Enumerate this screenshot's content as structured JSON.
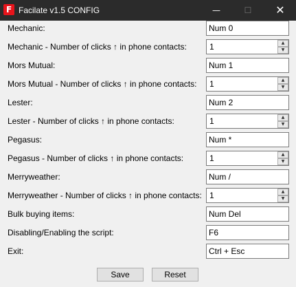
{
  "window": {
    "title": "Facilate v1.5 CONFIG",
    "icon_letter": "F",
    "minimize_glyph": "—",
    "maximize_glyph": "☐",
    "close_glyph": "✕",
    "icon": "app-logo-icon",
    "accent_color": "#e8141b"
  },
  "fields": {
    "mechanic_key": {
      "label": "Mechanic:",
      "value": "Num 0"
    },
    "mechanic_clicks": {
      "label": "Mechanic - Number of clicks ↑ in phone contacts:",
      "value": "1"
    },
    "mors_key": {
      "label": "Mors Mutual:",
      "value": "Num 1"
    },
    "mors_clicks": {
      "label": "Mors Mutual - Number of clicks ↑ in phone contacts:",
      "value": "1"
    },
    "lester_key": {
      "label": "Lester:",
      "value": "Num 2"
    },
    "lester_clicks": {
      "label": "Lester - Number of clicks ↑ in phone contacts:",
      "value": "1"
    },
    "pegasus_key": {
      "label": "Pegasus:",
      "value": "Num *"
    },
    "pegasus_clicks": {
      "label": "Pegasus - Number of clicks ↑ in phone contacts:",
      "value": "1"
    },
    "merry_key": {
      "label": "Merryweather:",
      "value": "Num /"
    },
    "merry_clicks": {
      "label": "Merryweather - Number of clicks ↑ in phone contacts:",
      "value": "1"
    },
    "bulk_key": {
      "label": "Bulk buying items:",
      "value": "Num Del"
    },
    "toggle_key": {
      "label": "Disabling/Enabling the script:",
      "value": "F6"
    },
    "exit_key": {
      "label": "Exit:",
      "value": "Ctrl + Esc"
    }
  },
  "spinner": {
    "up_glyph": "▲",
    "down_glyph": "▼"
  },
  "buttons": {
    "save": "Save",
    "reset": "Reset"
  }
}
